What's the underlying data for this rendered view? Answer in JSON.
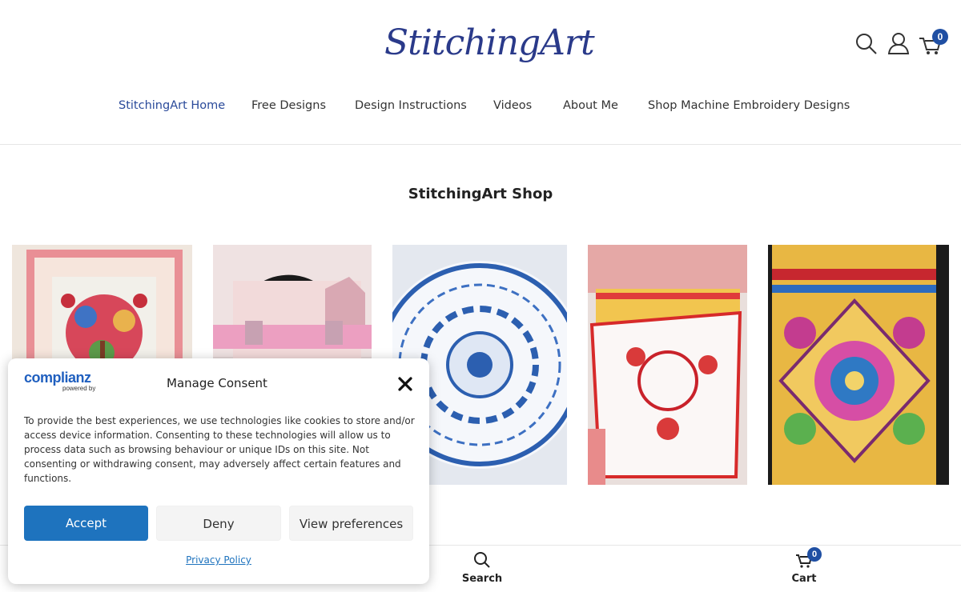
{
  "header": {
    "logo_text": "StitchingArt",
    "cart_count": "0"
  },
  "nav": {
    "items": [
      {
        "label": "StitchingArt Home",
        "active": true
      },
      {
        "label": "Free Designs"
      },
      {
        "label": "Design Instructions"
      },
      {
        "label": "Videos"
      },
      {
        "label": "About Me"
      },
      {
        "label": "Shop Machine Embroidery Designs"
      }
    ]
  },
  "shop": {
    "title": "StitchingArt Shop"
  },
  "consent": {
    "brand": "complianz",
    "brand_sub": "powered by",
    "title": "Manage Consent",
    "text": "To provide the best experiences, we use technologies like cookies to store and/or access device information. Consenting to these technologies will allow us to process data such as browsing behaviour or unique IDs on this site. Not consenting or withdrawing consent, may adversely affect certain features and functions.",
    "accept_label": "Accept",
    "deny_label": "Deny",
    "view_label": "View preferences",
    "privacy_label": "Privacy Policy"
  },
  "bottom_bar": {
    "search_label": "Search",
    "cart_label": "Cart",
    "cart_count": "0"
  },
  "colors": {
    "brand_blue": "#2a3a8a",
    "accent": "#1e73be",
    "badge": "#1f4fa3"
  }
}
